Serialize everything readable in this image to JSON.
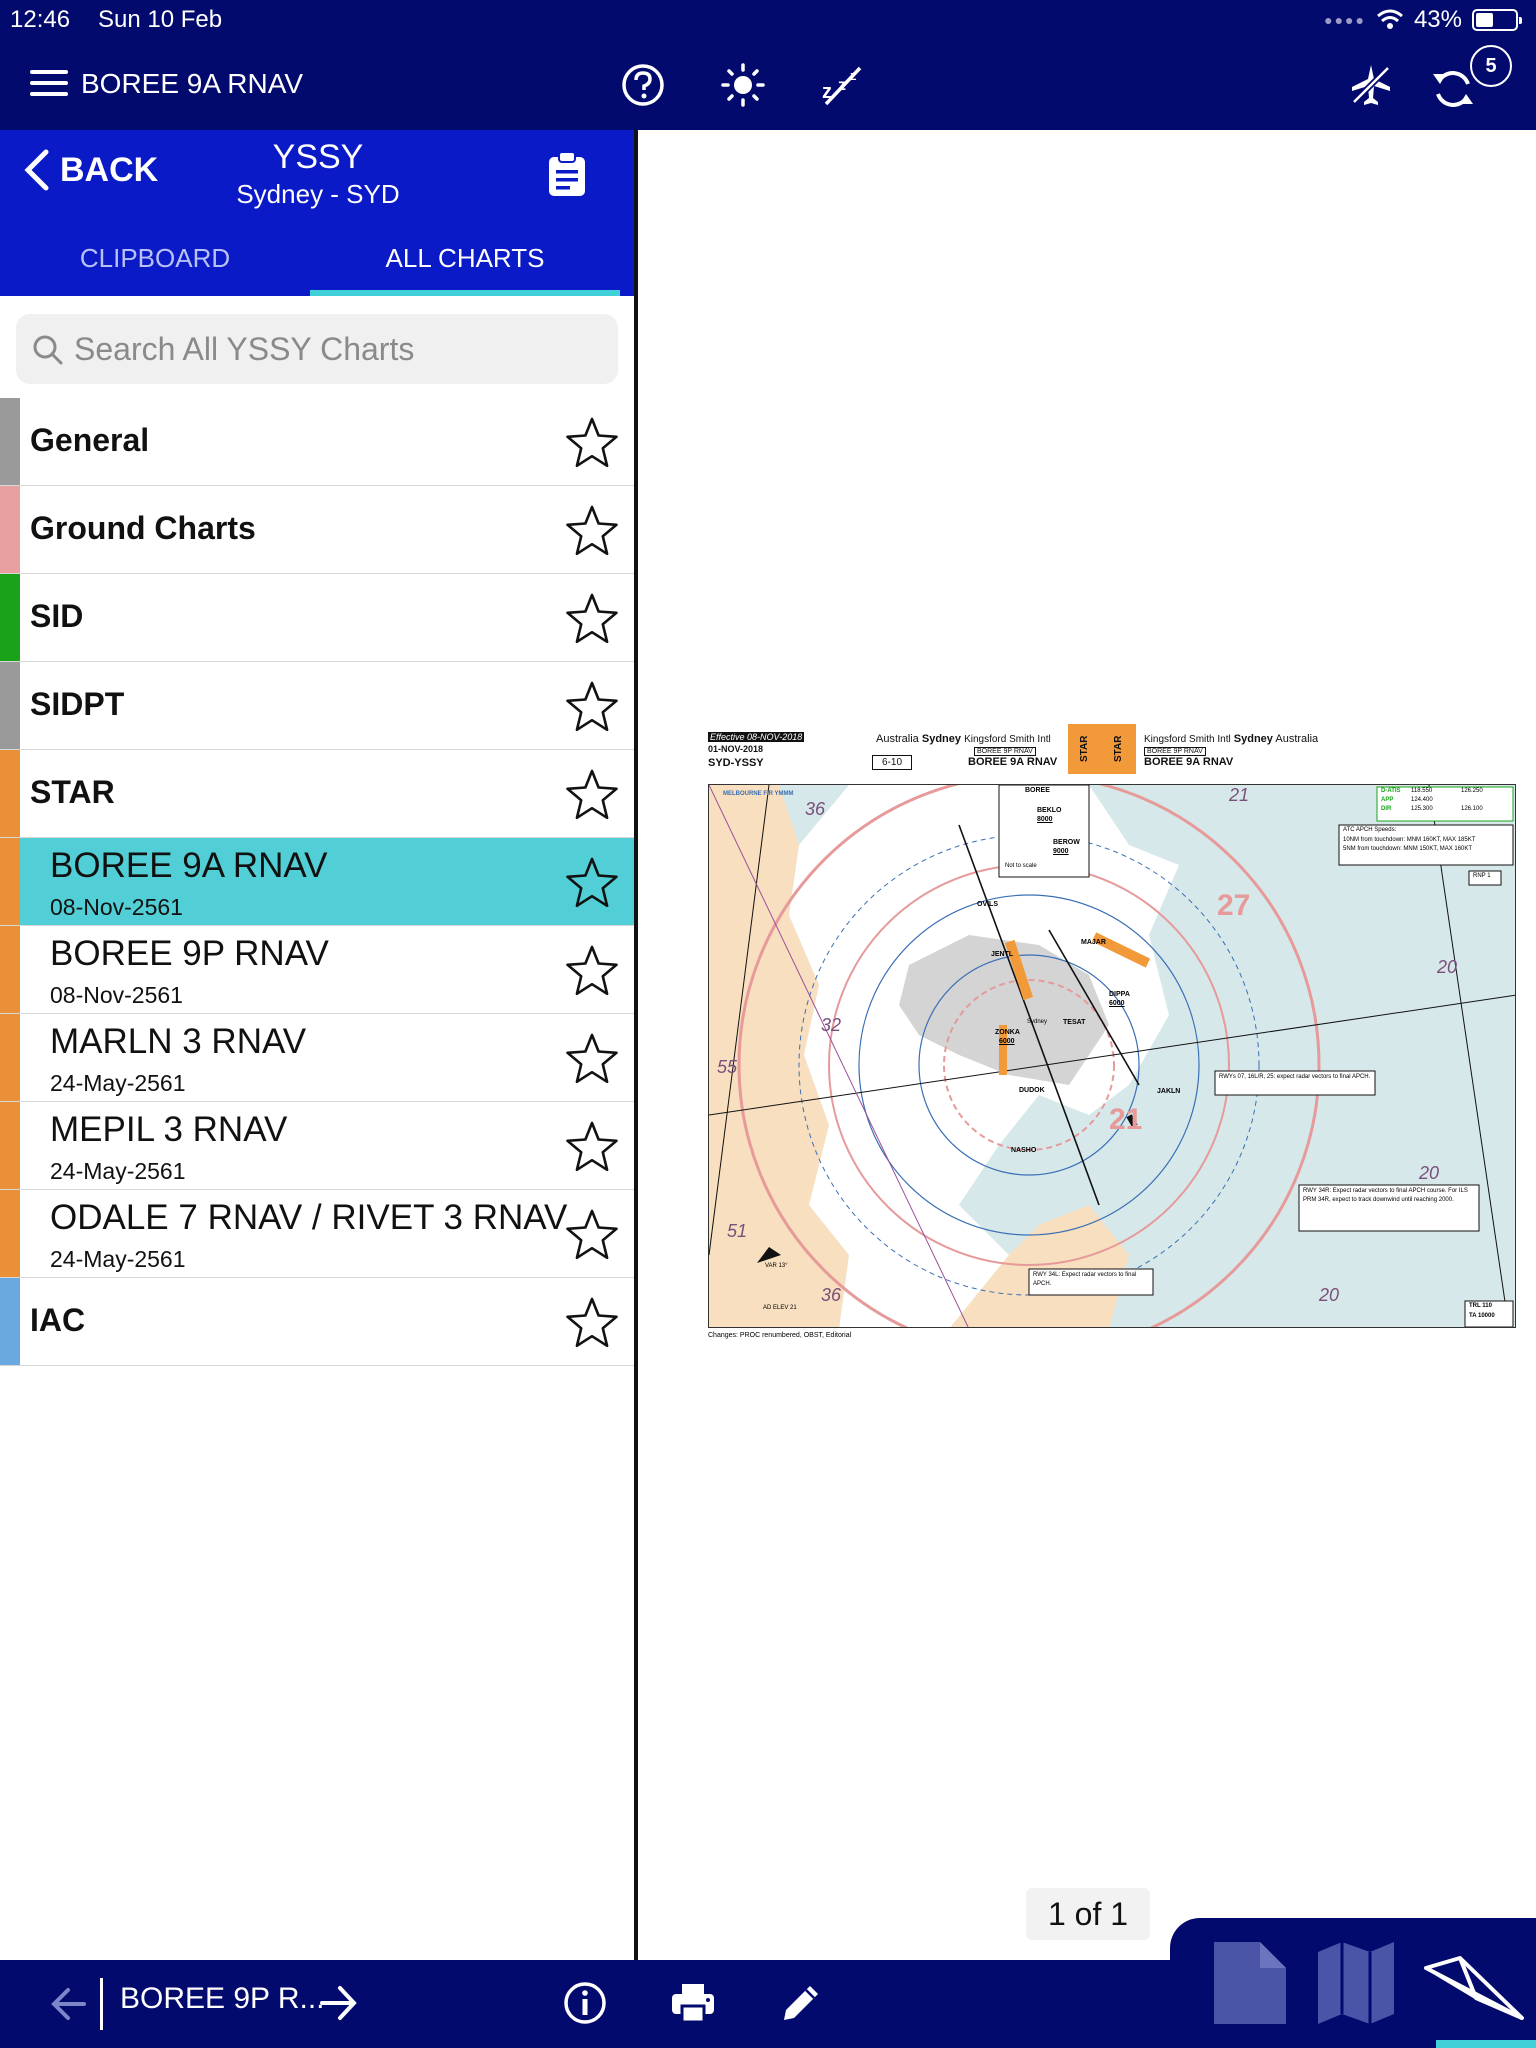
{
  "status_bar": {
    "time": "12:46",
    "date": "Sun 10 Feb",
    "battery": "43%"
  },
  "topbar": {
    "title": "BOREE 9A RNAV",
    "sync_count": "5"
  },
  "sidebar": {
    "back_label": "BACK",
    "airport_code": "YSSY",
    "airport_name": "Sydney - SYD",
    "tabs": [
      {
        "label": "CLIPBOARD"
      },
      {
        "label": "ALL CHARTS"
      }
    ],
    "search_placeholder": "Search All YSSY Charts",
    "categories": [
      {
        "label": "General",
        "color": "#9a9a9a"
      },
      {
        "label": "Ground Charts",
        "color": "#e9a0a0"
      },
      {
        "label": "SID",
        "color": "#1aa31a"
      },
      {
        "label": "SIDPT",
        "color": "#9a9a9a"
      },
      {
        "label": "STAR",
        "color": "#ea9038"
      },
      {
        "label": "IAC",
        "color": "#6aa8e0"
      }
    ],
    "charts": [
      {
        "name": "BOREE 9A RNAV",
        "date": "08-Nov-2561",
        "selected": true
      },
      {
        "name": "BOREE 9P RNAV",
        "date": "08-Nov-2561"
      },
      {
        "name": "MARLN 3 RNAV",
        "date": "24-May-2561"
      },
      {
        "name": "MEPIL 3 RNAV",
        "date": "24-May-2561"
      },
      {
        "name": "ODALE 7 RNAV / RIVET 3 RNAV",
        "date": "24-May-2561"
      }
    ]
  },
  "chart_doc": {
    "effective": "Effective 08-NOV-2018",
    "issue_date": "01-NOV-2018",
    "airport_ident": "SYD-YSSY",
    "left_country": "Australia",
    "left_city": "Sydney",
    "left_airport": "Kingsford Smith Intl",
    "page_ref": "6-10",
    "proc_box": "BOREE 9P RNAV",
    "proc_title": "BOREE 9A RNAV",
    "star_label": "STAR",
    "right_airport": "Kingsford Smith Intl",
    "right_city": "Sydney",
    "right_country": "Australia",
    "footer_note": "Changes: PROC renumbered, OBST, Editorial",
    "freq_labels": [
      "D-ATIS",
      "APP",
      "DIR"
    ],
    "freq_values": [
      "118.550",
      "124.400",
      "125.300"
    ],
    "alt_freq_values": [
      "126.250",
      "",
      "126.100"
    ],
    "atc_speed_title": "ATC APCH Speeds:",
    "atc_speed_line1": "10NM from touchdown: MNM 160KT, MAX 185KT",
    "atc_speed_line2": "5NM from touchdown: MNM 150KT, MAX 160KT",
    "rnp": "RNP 1",
    "waypoints": [
      "BOREE",
      "BEKLO",
      "BEROW",
      "OVILS",
      "MAJAR",
      "JENTL",
      "TESAT",
      "DIPPA",
      "ZONKA",
      "DUDOK",
      "JAKLN",
      "NASHO"
    ],
    "alt_beklo": "8000",
    "alt_berow": "9000",
    "alt_dippa": "6000",
    "alt_zonka": "6000",
    "not_to_scale": "Not to scale",
    "note2": "RWYs 07, 16L/R, 25: expect radar vectors to final APCH.",
    "note3": "RWY 34R: Expect radar vectors to final APCH course. For ILS PRM 34R, expect to track downwind until reaching 2000.",
    "note1": "RWY 34L: Expect radar vectors to final APCH.",
    "trl": "TRL 110",
    "ta": "TA 10000",
    "msa_labels": [
      "36",
      "32",
      "55",
      "51",
      "36",
      "21",
      "27",
      "20",
      "20",
      "20",
      "21"
    ],
    "map_label_fir": "MELBOURNE FIR YMMM",
    "map_label_elev": "AD ELEV 21",
    "map_label_var": "VAR 13°",
    "map_label_sydney": "Sydney"
  },
  "viewer": {
    "page_indicator": "1 of 1"
  },
  "bottombar": {
    "nav_title": "BOREE 9P R..."
  },
  "colors": {
    "navy": "#030a6e",
    "header_blue": "#0a1ac6",
    "accent_cyan": "#40d0d8",
    "selected_row": "#52cfd6"
  },
  "icons": [
    "menu-icon",
    "help-icon",
    "brightness-icon",
    "night-mode-off-icon",
    "airplane-mode-icon",
    "sync-icon",
    "clipboard-icon",
    "search-icon",
    "star-icon",
    "info-icon",
    "print-icon",
    "pencil-icon",
    "document-icon",
    "map-icon",
    "paper-plane-icon"
  ]
}
